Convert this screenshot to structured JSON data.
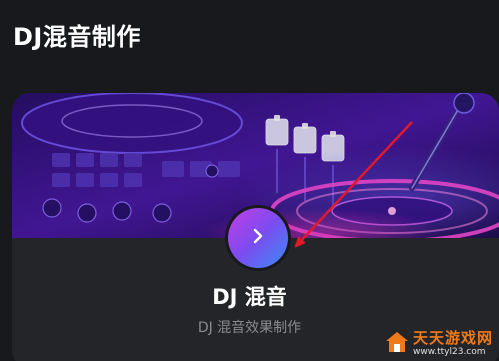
{
  "section": {
    "title": "DJ混音制作"
  },
  "card": {
    "title": "DJ 混音",
    "subtitle": "DJ 混音效果制作",
    "action_icon": "chevron-right-icon"
  },
  "watermark": {
    "title": "天天游戏网",
    "url": "www.ttyl23.com"
  },
  "colors": {
    "background": "#18191c",
    "card": "#242528",
    "accent_gradient": [
      "#c23ee6",
      "#3a8df5"
    ],
    "annotation_arrow": "#e0192b",
    "watermark": "#f07a1a"
  }
}
